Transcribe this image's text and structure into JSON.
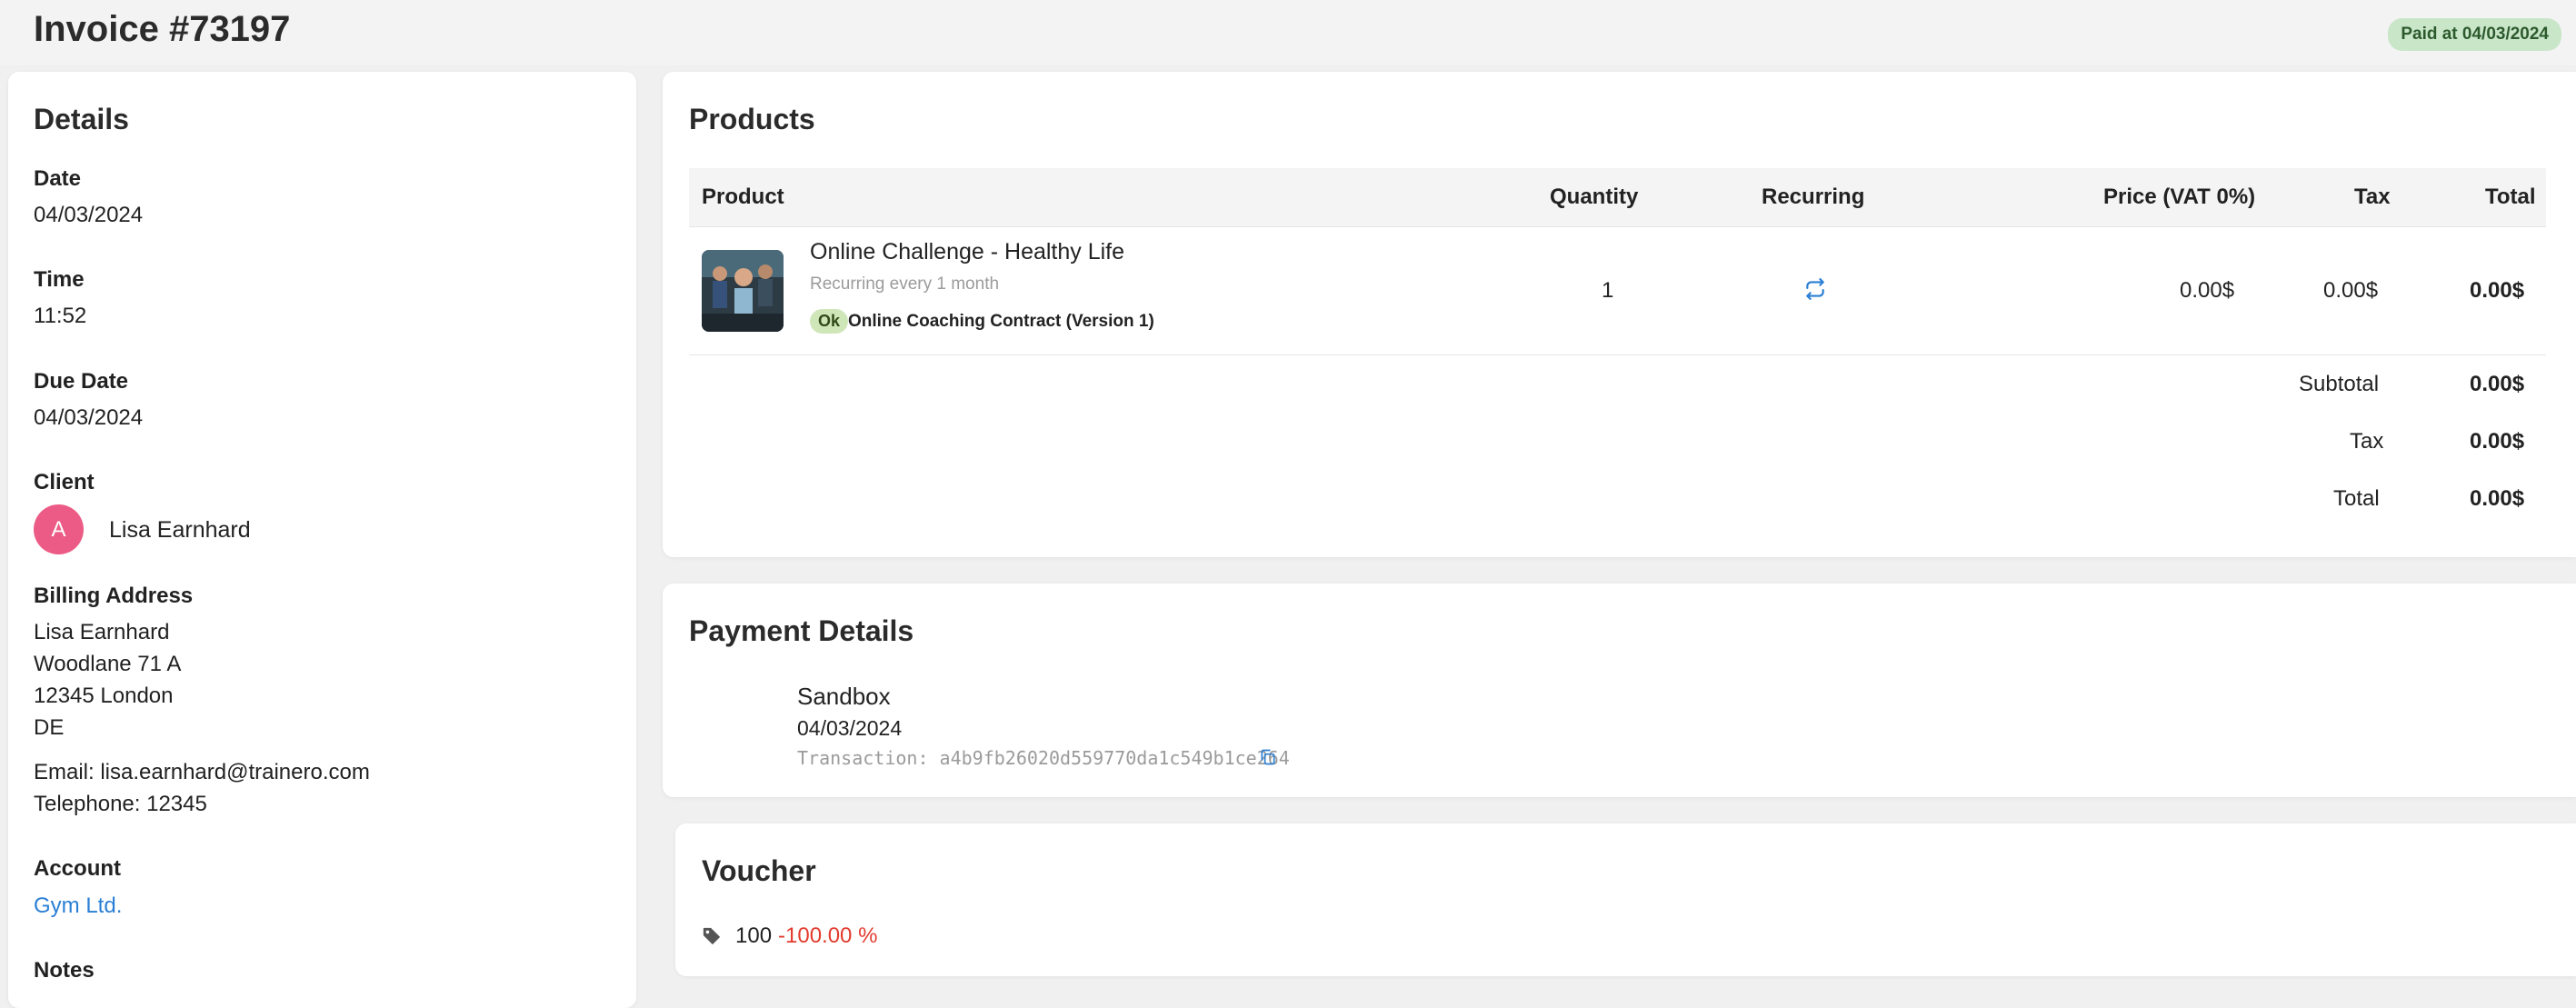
{
  "header": {
    "title": "Invoice #73197",
    "status_badge": "Paid at 04/03/2024"
  },
  "details": {
    "title": "Details",
    "date_label": "Date",
    "date_value": "04/03/2024",
    "time_label": "Time",
    "time_value": "11:52",
    "due_label": "Due Date",
    "due_value": "04/03/2024",
    "client_label": "Client",
    "client_avatar": "A",
    "client_name": "Lisa Earnhard",
    "billing_label": "Billing Address",
    "billing_lines": [
      "Lisa Earnhard",
      "Woodlane 71 A",
      "12345 London",
      "DE"
    ],
    "email": "Email: lisa.earnhard@trainero.com",
    "telephone": "Telephone: 12345",
    "account_label": "Account",
    "account_value": "Gym Ltd.",
    "notes_label": "Notes"
  },
  "products": {
    "title": "Products",
    "columns": [
      "Product",
      "Quantity",
      "Recurring",
      "Price (VAT 0%)",
      "Tax",
      "Total"
    ],
    "rows": [
      {
        "name": "Online Challenge - Healthy Life",
        "recurring_text": "Recurring every 1 month",
        "contract_badge": "Ok",
        "contract_name": "Online Coaching Contract (Version 1)",
        "quantity": "1",
        "recurring_icon": "recurring-icon",
        "price": "0.00$",
        "tax": "0.00$",
        "total": "0.00$"
      }
    ],
    "summary": {
      "subtotal_label": "Subtotal",
      "subtotal_value": "0.00$",
      "tax_label": "Tax",
      "tax_value": "0.00$",
      "total_label": "Total",
      "total_value": "0.00$"
    }
  },
  "payment": {
    "title": "Payment Details",
    "provider": "Sandbox",
    "date": "04/03/2024",
    "transaction": "Transaction: a4b9fb26020d559770da1c549b1ce264",
    "copy_icon": "copy-icon"
  },
  "voucher": {
    "title": "Voucher",
    "icon": "tag-icon",
    "code": "100",
    "discount": "-100.00 %"
  },
  "colors": {
    "link": "#2a7fd4",
    "avatar": "#ec5b85",
    "paid_badge_bg": "#c9e6c9",
    "ok_badge_bg": "#cfe6b8",
    "discount": "#e23b2e"
  }
}
